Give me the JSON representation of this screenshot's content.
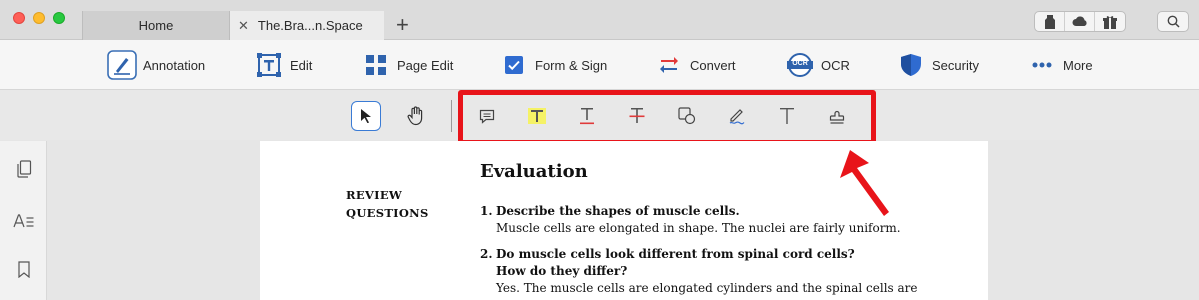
{
  "tabs": {
    "home": "Home",
    "doc_close": "✕",
    "doc": "The.Bra...n.Space",
    "add": "+"
  },
  "menu": {
    "annotation": "Annotation",
    "edit": "Edit",
    "page_edit": "Page Edit",
    "form_sign": "Form & Sign",
    "convert": "Convert",
    "ocr": "OCR",
    "ocr_badge": "OCR",
    "security": "Security",
    "more": "More"
  },
  "colors": {
    "accent": "#3a7bd5",
    "highlight_outline": "#e8141a",
    "text_highlight_yellow": "#f5f266",
    "underline_red": "#e03a3a"
  },
  "tools": [
    "select-icon",
    "hand-icon",
    "comment-icon",
    "highlight-text-icon",
    "underline-text-icon",
    "strikethrough-text-icon",
    "shape-icon",
    "pencil-icon",
    "text-box-icon",
    "stamp-icon"
  ],
  "sidebar": [
    "thumbnails-icon",
    "outline-icon",
    "bookmark-icon"
  ],
  "document": {
    "title": "Evaluation",
    "section_label_1": "REVIEW",
    "section_label_2": "QUESTIONS",
    "q1": {
      "num": "1.",
      "text": "Describe the shapes of muscle cells.",
      "answer": "Muscle cells are elongated in shape. The nuclei are fairly uniform."
    },
    "q2": {
      "num": "2.",
      "text1": "Do muscle cells look different from spinal cord cells?",
      "text2": "How do they differ?",
      "answer": "Yes. The muscle cells are elongated cylinders and the spinal cells are"
    }
  }
}
